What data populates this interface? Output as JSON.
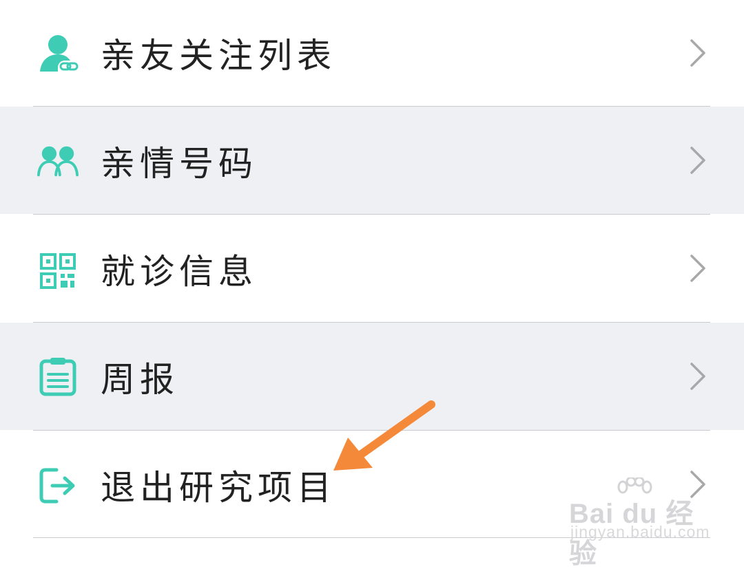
{
  "menu": {
    "items": [
      {
        "label": "亲友关注列表",
        "icon": "user-link-icon"
      },
      {
        "label": "亲情号码",
        "icon": "users-icon"
      },
      {
        "label": "就诊信息",
        "icon": "qr-code-icon"
      },
      {
        "label": "周报",
        "icon": "clipboard-icon"
      },
      {
        "label": "退出研究项目",
        "icon": "logout-icon"
      }
    ]
  },
  "colors": {
    "accent": "#3ecdb4",
    "row_alt_background": "#eff0f4",
    "chevron": "#a8a8ab",
    "annotation_arrow": "#f5893a"
  },
  "watermark": {
    "brand": "Bai du 经验",
    "url": "jingyan.baidu.com"
  }
}
